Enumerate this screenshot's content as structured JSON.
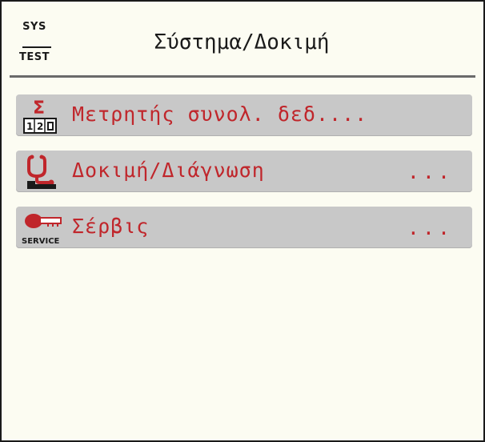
{
  "header": {
    "sys_label": "SYS",
    "test_label": "TEST",
    "title": "Σύστημα/Δοκιμή"
  },
  "menu": {
    "items": [
      {
        "label": "Μετρητής συνολ. δεδ....",
        "ellipsis": "",
        "icon": "sum-counter-icon"
      },
      {
        "label": "Δοκιμή/Διάγνωση",
        "ellipsis": "...",
        "icon": "stethoscope-icon"
      },
      {
        "label": "Σέρβις",
        "ellipsis": "...",
        "icon": "service-key-icon"
      }
    ],
    "service_icon_text": "SERVICE",
    "counter_icon_text": "12"
  },
  "colors": {
    "label_text": "#c0262b",
    "item_background": "#c8c8c8",
    "screen_background": "#fcfcf2",
    "icon_red": "#c0262b"
  }
}
